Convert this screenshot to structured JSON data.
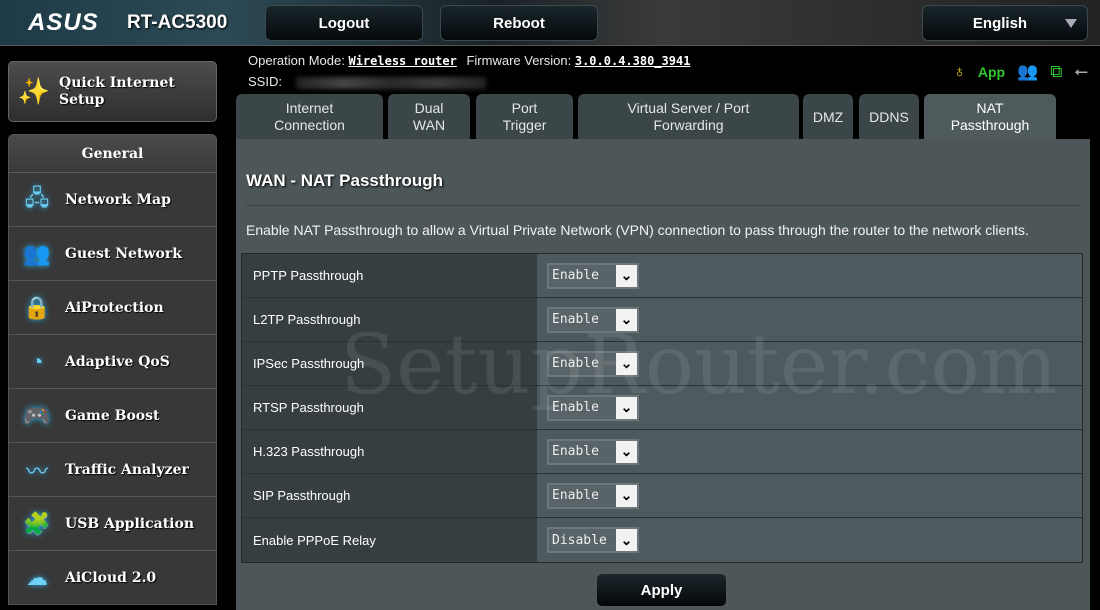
{
  "header": {
    "brand": "ASUS",
    "model": "RT-AC5300",
    "logout": "Logout",
    "reboot": "Reboot",
    "language": "English"
  },
  "quick_setup": {
    "label_line1": "Quick Internet",
    "label_line2": "Setup"
  },
  "sidebar": {
    "heading": "General",
    "items": [
      {
        "label": "Network Map",
        "icon": "network-map-icon"
      },
      {
        "label": "Guest Network",
        "icon": "guest-network-icon"
      },
      {
        "label": "AiProtection",
        "icon": "lock-icon"
      },
      {
        "label": "Adaptive QoS",
        "icon": "speedometer-icon"
      },
      {
        "label": "Game Boost",
        "icon": "gamepad-icon"
      },
      {
        "label": "Traffic Analyzer",
        "icon": "chart-icon"
      },
      {
        "label": "USB Application",
        "icon": "puzzle-icon"
      },
      {
        "label": "AiCloud 2.0",
        "icon": "cloud-house-icon"
      }
    ]
  },
  "info": {
    "op_mode_label": "Operation Mode:",
    "op_mode": "Wireless router",
    "fw_label": "Firmware Version:",
    "fw": "3.0.0.4.380_3941",
    "ssid_label": "SSID:"
  },
  "status": {
    "app": "App",
    "colors": {
      "app": "#2fc72f",
      "bulb": "#e6d22a",
      "clients": "#888888",
      "usb": "#aaaaaa"
    }
  },
  "tabs": [
    {
      "line1": "Internet",
      "line2": "Connection"
    },
    {
      "line1": "Dual",
      "line2": "WAN"
    },
    {
      "line1": "Port",
      "line2": "Trigger"
    },
    {
      "line1": "Virtual Server / Port",
      "line2": "Forwarding"
    },
    {
      "line1": "DMZ",
      "line2": ""
    },
    {
      "line1": "DDNS",
      "line2": ""
    },
    {
      "line1": "NAT",
      "line2": "Passthrough",
      "active": true
    }
  ],
  "main": {
    "title": "WAN - NAT Passthrough",
    "description": "Enable NAT Passthrough to allow a Virtual Private Network (VPN) connection to pass through the router to the network clients.",
    "rows": [
      {
        "label": "PPTP Passthrough",
        "value": "Enable"
      },
      {
        "label": "L2TP Passthrough",
        "value": "Enable"
      },
      {
        "label": "IPSec Passthrough",
        "value": "Enable"
      },
      {
        "label": "RTSP Passthrough",
        "value": "Enable"
      },
      {
        "label": "H.323 Passthrough",
        "value": "Enable"
      },
      {
        "label": "SIP Passthrough",
        "value": "Enable"
      },
      {
        "label": "Enable PPPoE Relay",
        "value": "Disable"
      }
    ],
    "apply": "Apply"
  },
  "watermark": "SetupRouter.com"
}
